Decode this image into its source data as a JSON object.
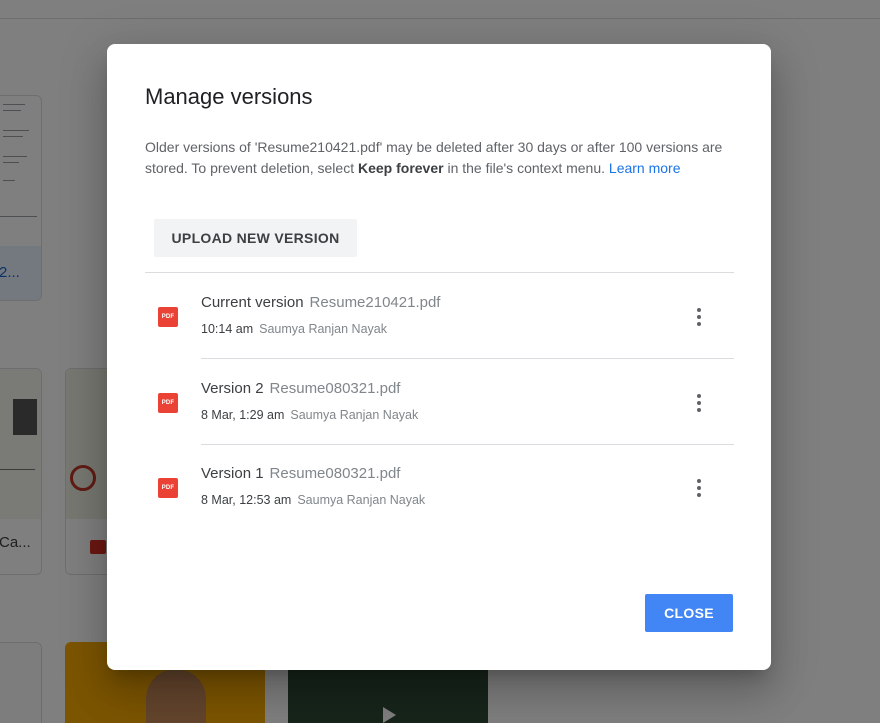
{
  "background": {
    "cards": [
      {
        "label": "2..."
      },
      {
        "label": "Ca..."
      },
      {
        "label": ""
      },
      {
        "label": ""
      },
      {
        "label": ""
      }
    ]
  },
  "dialog": {
    "title": "Manage versions",
    "description": {
      "part1": "Older versions of 'Resume210421.pdf' may be deleted after 30 days or after 100 versions are stored. To prevent deletion, select ",
      "bold": "Keep forever",
      "part2": " in the file's context menu. ",
      "link": "Learn more"
    },
    "upload_button": "UPLOAD NEW VERSION",
    "versions": [
      {
        "label": "Current version",
        "filename": "Resume210421.pdf",
        "time": "10:14 am",
        "author": "Saumya Ranjan Nayak",
        "icon": "pdf-icon"
      },
      {
        "label": "Version 2",
        "filename": "Resume080321.pdf",
        "time": "8 Mar, 1:29 am",
        "author": "Saumya Ranjan Nayak",
        "icon": "pdf-icon"
      },
      {
        "label": "Version 1",
        "filename": "Resume080321.pdf",
        "time": "8 Mar, 12:53 am",
        "author": "Saumya Ranjan Nayak",
        "icon": "pdf-icon"
      }
    ],
    "pdf_badge": "PDF",
    "close_button": "CLOSE"
  },
  "colors": {
    "accent": "#4285f4",
    "link": "#1a73e8",
    "pdf": "#ea4335",
    "scrim": "rgba(0,0,0,0.5)"
  }
}
